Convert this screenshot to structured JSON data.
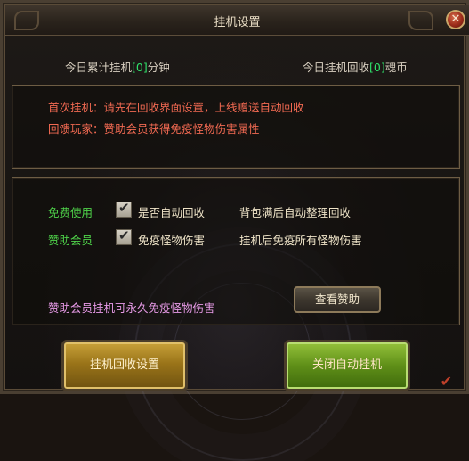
{
  "window": {
    "title": "挂机设置",
    "close_icon": "close-icon",
    "close_symbol": "✕"
  },
  "stats": {
    "left_prefix": "今日累计挂机",
    "left_value": "[0]",
    "left_suffix": "分钟",
    "right_prefix": "今日挂机回收",
    "right_value": "[0]",
    "right_suffix": "魂币"
  },
  "notice": {
    "line1": "首次挂机：请先在回收界面设置，上线赠送自动回收",
    "line2": "回馈玩家：赞助会员获得免疫怪物伤害属性"
  },
  "options": [
    {
      "label": "免费使用",
      "checkbox_text": "是否自动回收",
      "checked": true,
      "description": "背包满后自动整理回收"
    },
    {
      "label": "赞助会员",
      "checkbox_text": "免疫怪物伤害",
      "checked": true,
      "description": "挂机后免疫所有怪物伤害"
    }
  ],
  "sponsor": {
    "text": "赞助会员挂机可永久免疫怪物伤害",
    "button_label": "查看赞助"
  },
  "buttons": {
    "recycle_settings": "挂机回收设置",
    "close_auto": "关闭自动挂机"
  },
  "checkmark": "✔",
  "colors": {
    "accent_green": "#2fe06a",
    "notice_red": "#f26a52",
    "label_green": "#4fd34a",
    "desc_blue": "#56b5f0",
    "sponsor_pink": "#e89be8"
  }
}
